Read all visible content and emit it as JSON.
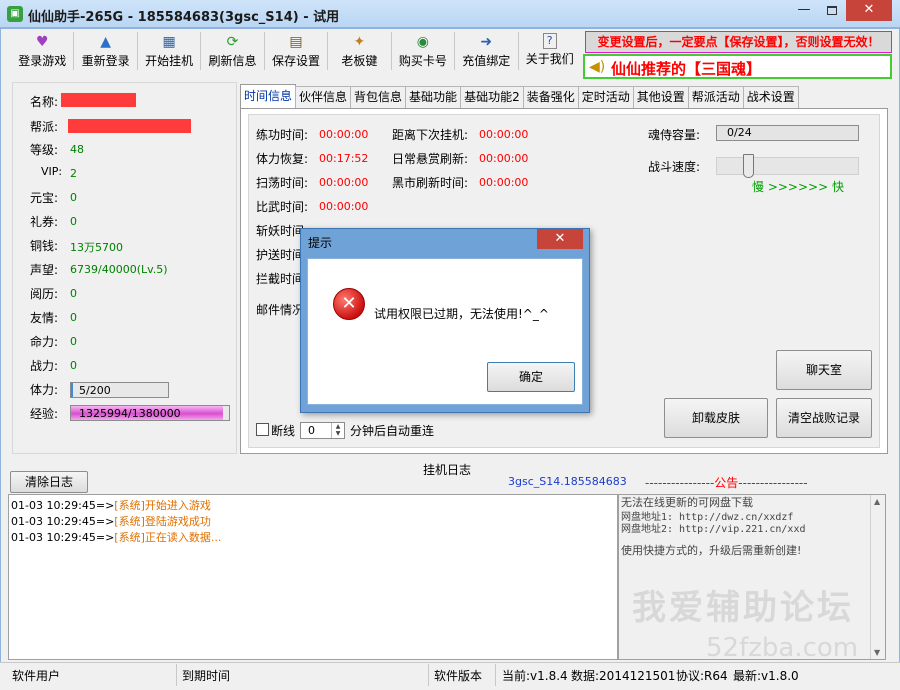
{
  "window": {
    "title": "仙仙助手-265G - 185584683(3gsc_S14) - 试用",
    "app_icon": "gamepad-icon"
  },
  "toolbar": {
    "items": [
      {
        "label": "登录游戏",
        "icon": "heart-login-icon"
      },
      {
        "label": "重新登录",
        "icon": "relogin-arrow-icon"
      },
      {
        "label": "开始挂机",
        "icon": "calendar-start-icon"
      },
      {
        "label": "刷新信息",
        "icon": "refresh-icon"
      },
      {
        "label": "保存设置",
        "icon": "save-settings-icon"
      },
      {
        "label": "老板键",
        "icon": "boss-key-icon"
      },
      {
        "label": "购买卡号",
        "icon": "globe-buy-icon"
      },
      {
        "label": "充值绑定",
        "icon": "recharge-bind-icon"
      },
      {
        "label": "关于我们",
        "icon": "help-icon"
      }
    ]
  },
  "notice": {
    "text": "变更设置后，一定要点【保存设置】，否则设置无效！",
    "promo": "仙仙推荐的【三国魂】",
    "promo_icon": "speaker-icon"
  },
  "info": {
    "name_label": "名称:",
    "guild_label": "帮派:",
    "level_label": "等级:",
    "level_value": "48",
    "vip_label": "VIP:",
    "vip_value": "2",
    "yuanbao_label": "元宝:",
    "yuanbao_value": "0",
    "coupon_label": "礼券:",
    "coupon_value": "0",
    "copper_label": "铜钱:",
    "copper_value": "13万5700",
    "prestige_label": "声望:",
    "prestige_value": "6739/40000(Lv.5)",
    "experience_label": "阅历:",
    "experience_value": "0",
    "friendship_label": "友情:",
    "friendship_value": "0",
    "lifeforce_label": "命力:",
    "lifeforce_value": "0",
    "power_label": "战力:",
    "power_value": "0",
    "stamina_label": "体力:",
    "stamina_text": "5/200",
    "stamina_fraction": 0.025,
    "exp_label": "经验:",
    "exp_text": "1325994/1380000",
    "exp_fraction": 0.961
  },
  "tabs": [
    "时间信息",
    "伙伴信息",
    "背包信息",
    "基础功能",
    "基础功能2",
    "装备强化",
    "定时活动",
    "其他设置",
    "帮派活动",
    "战术设置"
  ],
  "time_info": {
    "practice_label": "练功时间:",
    "practice_value": "00:00:00",
    "stamina_label": "体力恢复:",
    "stamina_value": "00:17:52",
    "sweep_label": "扫荡时间:",
    "sweep_value": "00:00:00",
    "duel_label": "比武时间:",
    "duel_value": "00:00:00",
    "demon_label": "斩妖时间",
    "escort_label": "护送时间",
    "intercept_label": "拦截时间",
    "mail_label": "邮件情况",
    "next_idle_label": "距离下次挂机:",
    "next_idle_value": "00:00:00",
    "bounty_label": "日常悬赏刷新:",
    "bounty_value": "00:00:00",
    "blackmarket_label": "黑市刷新时间:",
    "blackmarket_value": "00:00:00",
    "soul_label": "魂侍容量:",
    "soul_value": "0/24",
    "speed_label": "战斗速度:",
    "speed_scale": "慢 >>>>>> 快",
    "speed_fraction": 0.2
  },
  "buttons": {
    "chat": "聊天室",
    "uninstall_skin": "卸载皮肤",
    "clear_defeats": "清空战败记录"
  },
  "reconnect": {
    "checkbox_label": "断线",
    "minutes_value": "0",
    "suffix": "分钟后自动重连"
  },
  "log": {
    "clear_label": "清除日志",
    "title": "挂机日志",
    "account": "3gsc_S14.185584683",
    "announce_title": "----------------公告----------------",
    "lines": [
      {
        "ts": "01-03 10:29:45=>",
        "msg": "[系统]开始进入游戏"
      },
      {
        "ts": "01-03 10:29:45=>",
        "msg": "[系统]登陆游戏成功"
      },
      {
        "ts": "01-03 10:29:45=>",
        "msg": "[系统]正在读入数据..."
      }
    ]
  },
  "announcement": {
    "line1": "无法在线更新的可网盘下载",
    "line2": "网盘地址1: http://dwz.cn/xxdzf",
    "line3": "网盘地址2: http://vip.221.cn/xxd",
    "line4": "使用快捷方式的，升级后需重新创建!",
    "watermark": "我爱辅助论坛",
    "watermark_url": "52fzba.com"
  },
  "status": {
    "user": "软件用户",
    "expire": "到期时间",
    "version_label": "软件版本",
    "current": "当前:v1.8.4",
    "data": "数据:2014121501",
    "protocol": "协议:R64",
    "latest": "最新:v1.8.0"
  },
  "dialog": {
    "title": "提示",
    "message": "试用权限已过期，无法使用!^_^",
    "ok": "确定",
    "icon": "error-icon"
  }
}
